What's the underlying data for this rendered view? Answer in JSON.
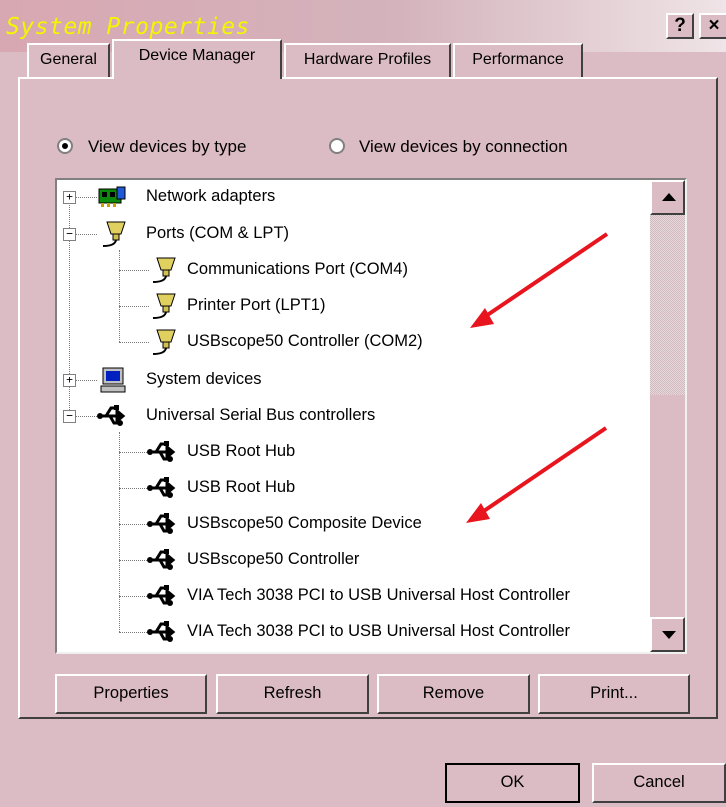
{
  "window": {
    "title": "System Properties",
    "help_button": "?",
    "close_button": "×"
  },
  "tabs": [
    {
      "label": "General"
    },
    {
      "label": "Device Manager"
    },
    {
      "label": "Hardware Profiles"
    },
    {
      "label": "Performance"
    }
  ],
  "view_options": {
    "by_type": {
      "label": "View devices by type",
      "selected": true
    },
    "by_connection": {
      "label": "View devices by connection",
      "selected": false
    }
  },
  "tree": {
    "network_adapters": "Network adapters",
    "ports": "Ports (COM & LPT)",
    "ports_children": [
      "Communications Port (COM4)",
      "Printer Port (LPT1)",
      "USBscope50 Controller (COM2)"
    ],
    "system_devices": "System devices",
    "usb_controllers": "Universal Serial Bus controllers",
    "usb_children": [
      "USB Root Hub",
      "USB Root Hub",
      "USBscope50 Composite Device",
      "USBscope50 Controller",
      "VIA Tech 3038 PCI to USB Universal Host Controller",
      "VIA Tech 3038 PCI to USB Universal Host Controller"
    ]
  },
  "buttons": {
    "properties": "Properties",
    "refresh": "Refresh",
    "remove": "Remove",
    "print": "Print...",
    "ok": "OK",
    "cancel": "Cancel"
  },
  "colors": {
    "title_text": "#f4f600",
    "window_face": "#dcbcc4",
    "annotation_arrow": "#e8141e"
  }
}
